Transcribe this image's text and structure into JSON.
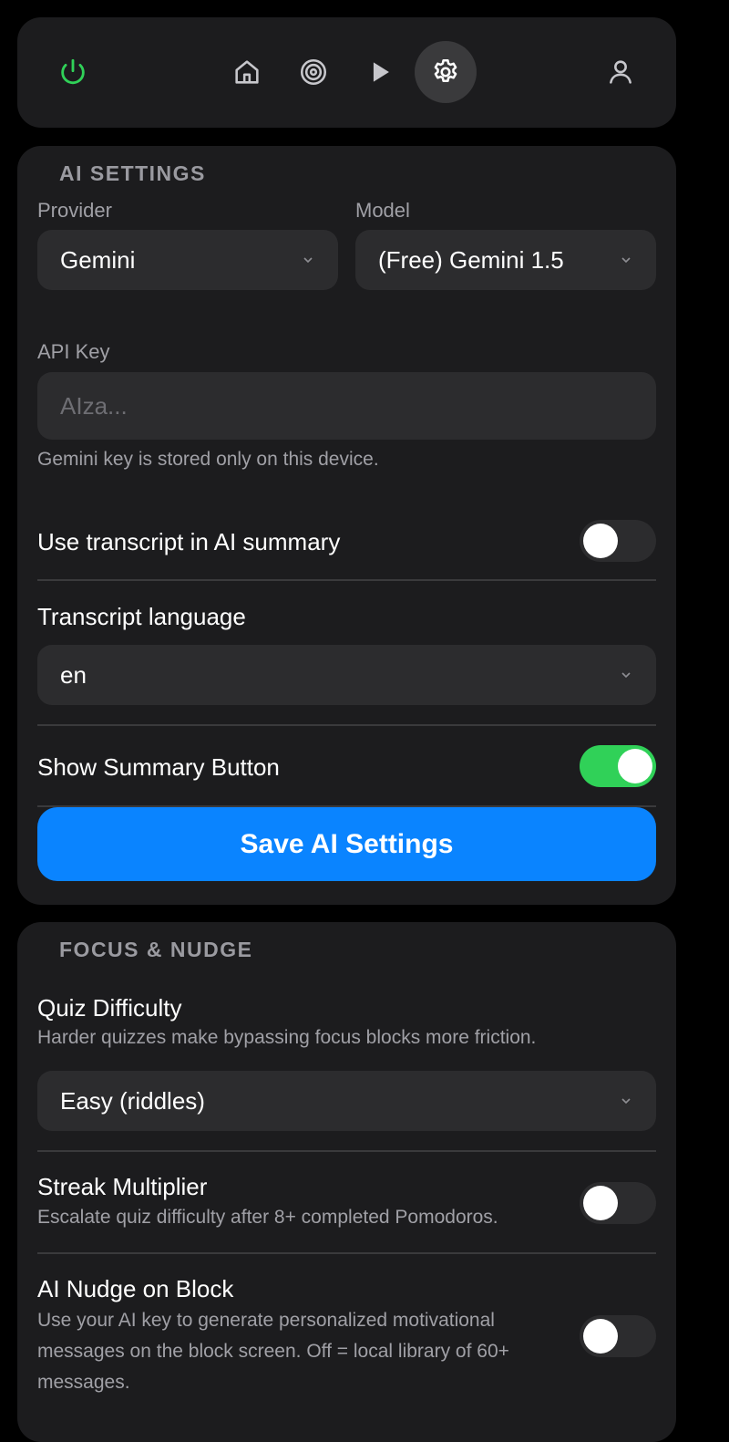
{
  "nav": {
    "icons": {
      "power": "power-icon",
      "home": "home-icon",
      "focus": "target-icon",
      "play": "play-icon",
      "settings": "gear-icon",
      "profile": "user-icon"
    },
    "active": "settings"
  },
  "ai_settings": {
    "title": "AI SETTINGS",
    "provider": {
      "label": "Provider",
      "value": "Gemini"
    },
    "model": {
      "label": "Model",
      "value": "(Free) Gemini 1.5"
    },
    "api_key": {
      "label": "API Key",
      "placeholder": "AIza...",
      "value": "",
      "hint": "Gemini key is stored only on this device."
    },
    "use_transcript": {
      "label": "Use transcript in AI summary",
      "enabled": false
    },
    "transcript_language": {
      "label": "Transcript language",
      "value": "en"
    },
    "show_summary_button": {
      "label": "Show Summary Button",
      "enabled": true
    },
    "save_label": "Save AI Settings"
  },
  "focus_nudge": {
    "title": "FOCUS & NUDGE",
    "quiz_difficulty": {
      "label": "Quiz Difficulty",
      "description": "Harder quizzes make bypassing focus blocks more friction.",
      "value": "Easy (riddles)"
    },
    "streak_multiplier": {
      "label": "Streak Multiplier",
      "description": "Escalate quiz difficulty after 8+ completed Pomodoros.",
      "enabled": false
    },
    "ai_nudge": {
      "label": "AI Nudge on Block",
      "description": "Use your AI key to generate personalized motivational messages on the block screen. Off = local library of 60+ messages.",
      "enabled": false
    }
  },
  "colors": {
    "background": "#000000",
    "card": "#1c1c1e",
    "field": "#2c2c2e",
    "accent": "#0a84ff",
    "toggle_on": "#30d158",
    "power_icon": "#30d158"
  }
}
